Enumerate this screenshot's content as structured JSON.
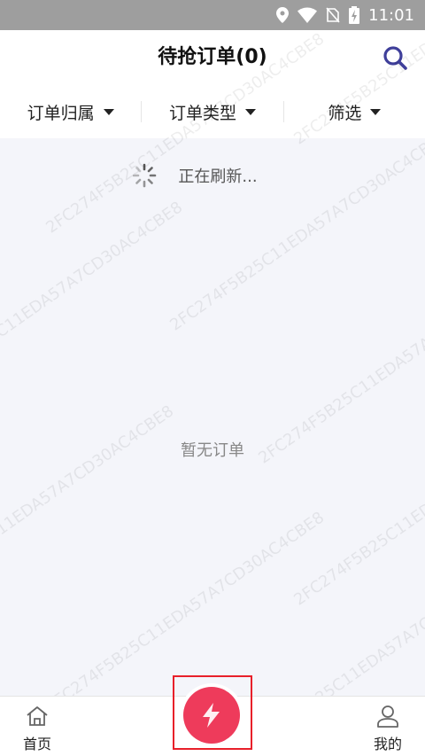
{
  "status_bar": {
    "time": "11:01"
  },
  "header": {
    "title": "待抢订单(0)"
  },
  "filters": [
    {
      "label": "订单归属"
    },
    {
      "label": "订单类型"
    },
    {
      "label": "筛选"
    }
  ],
  "refresh": {
    "text": "正在刷新..."
  },
  "empty": {
    "text": "暂无订单"
  },
  "tabs": {
    "home": "首页",
    "me": "我的"
  },
  "watermark": "2FC274F5B25C11EDA57A7CD30AC4CBE8",
  "colors": {
    "accent": "#ee3b5b",
    "search": "#3f3f9a",
    "highlight": "#e8202a"
  }
}
